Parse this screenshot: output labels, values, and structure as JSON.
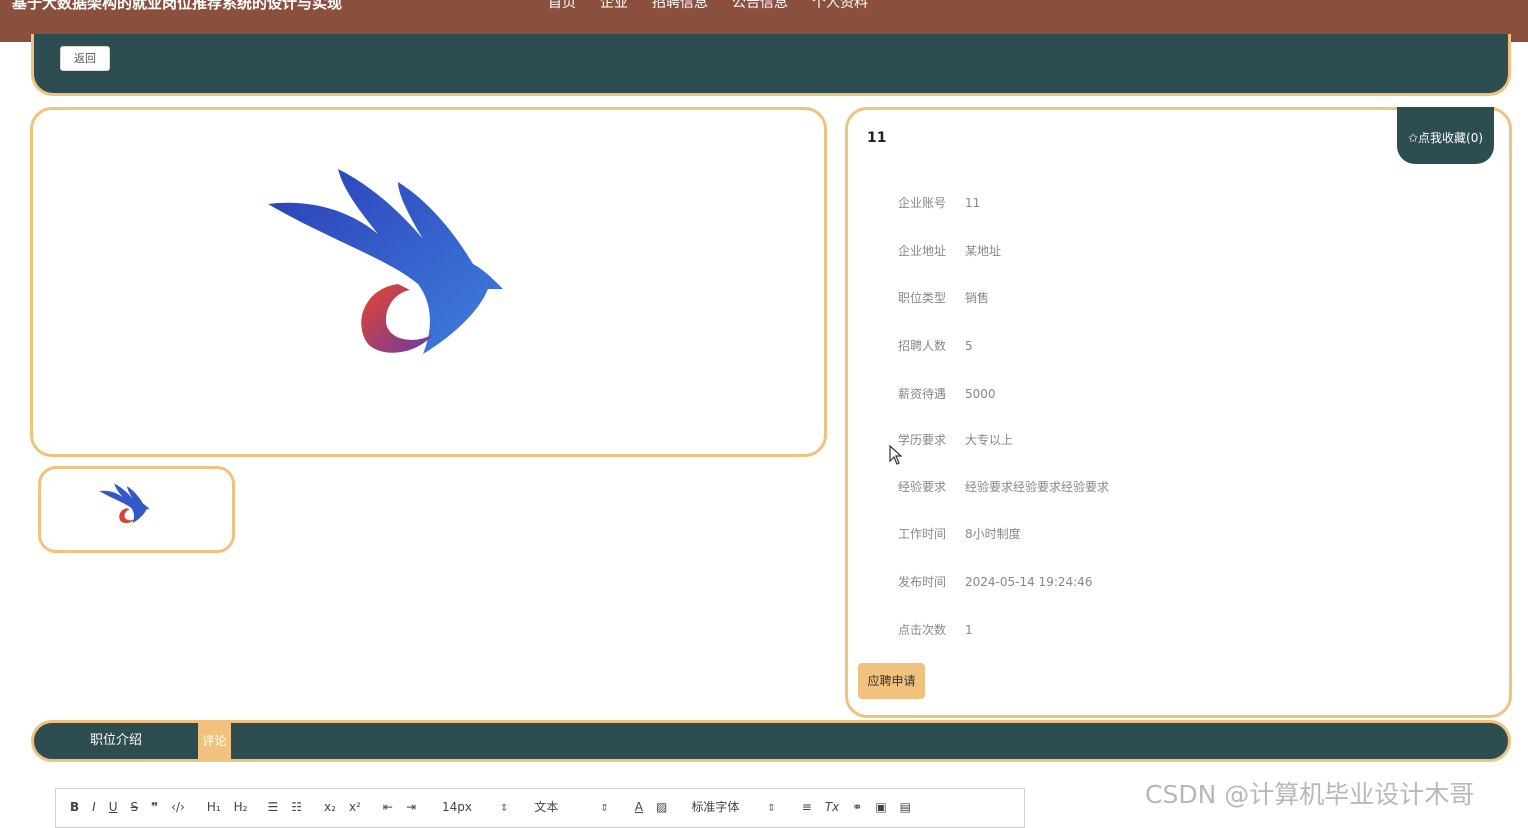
{
  "header": {
    "site_title": "基于大数据架构的就业岗位推荐系统的设计与实现",
    "nav": [
      "首页",
      "企业",
      "招聘信息",
      "公告信息",
      "个人资料"
    ]
  },
  "back_button": "返回",
  "detail": {
    "title": "11",
    "favorite_button": "✩点我收藏(0)",
    "fields": [
      {
        "label": "企业账号",
        "value": "11"
      },
      {
        "label": "企业地址",
        "value": "某地址"
      },
      {
        "label": "职位类型",
        "value": "销售"
      },
      {
        "label": "招聘人数",
        "value": "5"
      },
      {
        "label": "薪资待遇",
        "value": "5000"
      },
      {
        "label": "学历要求",
        "value": "大专以上"
      },
      {
        "label": "经验要求",
        "value": "经验要求经验要求经验要求"
      },
      {
        "label": "工作时间",
        "value": "8小时制度"
      },
      {
        "label": "发布时间",
        "value": "2024-05-14 19:24:46"
      },
      {
        "label": "点击次数",
        "value": "1"
      }
    ],
    "apply_button": "应聘申请"
  },
  "tabs": {
    "intro": "职位介绍",
    "comment": "评论"
  },
  "editor": {
    "font_size": "14px",
    "paragraph": "文本",
    "font_family": "标准字体"
  },
  "watermark": "CSDN @计算机毕业设计木哥",
  "colors": {
    "header_bg": "#8a4f3d",
    "panel_dark": "#2d4d50",
    "accent": "#f0c27e"
  }
}
